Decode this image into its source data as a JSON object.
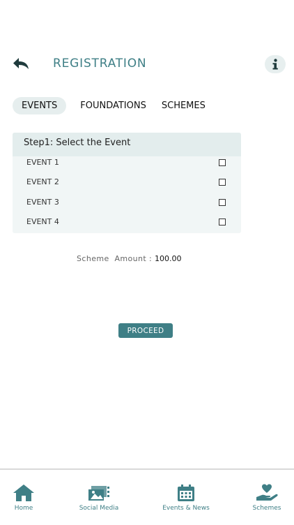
{
  "header": {
    "title": "REGISTRATION"
  },
  "tabs": [
    {
      "label": "EVENTS",
      "active": true
    },
    {
      "label": "FOUNDATIONS",
      "active": false
    },
    {
      "label": "SCHEMES",
      "active": false
    }
  ],
  "card": {
    "title": "Step1: Select the Event",
    "items": [
      {
        "label": "EVENT 1",
        "checked": false
      },
      {
        "label": "EVENT 2",
        "checked": false
      },
      {
        "label": "EVENT 3",
        "checked": false
      },
      {
        "label": "EVENT 4",
        "checked": false
      }
    ]
  },
  "scheme": {
    "label": "Scheme  Amount : ",
    "value": "100.00"
  },
  "proceed_label": "PROCEED",
  "bottom_nav": [
    {
      "label": "Home",
      "icon": "home-icon"
    },
    {
      "label": "Social Media",
      "icon": "social-media-icon"
    },
    {
      "label": "Events & News",
      "icon": "calendar-icon"
    },
    {
      "label": "Schemes",
      "icon": "heart-hand-icon"
    }
  ],
  "colors": {
    "accent": "#3f7f86",
    "tab_active_bg": "#e6eeee",
    "card_bg": "#f1f6f6",
    "card_head_bg": "#e3eded"
  }
}
